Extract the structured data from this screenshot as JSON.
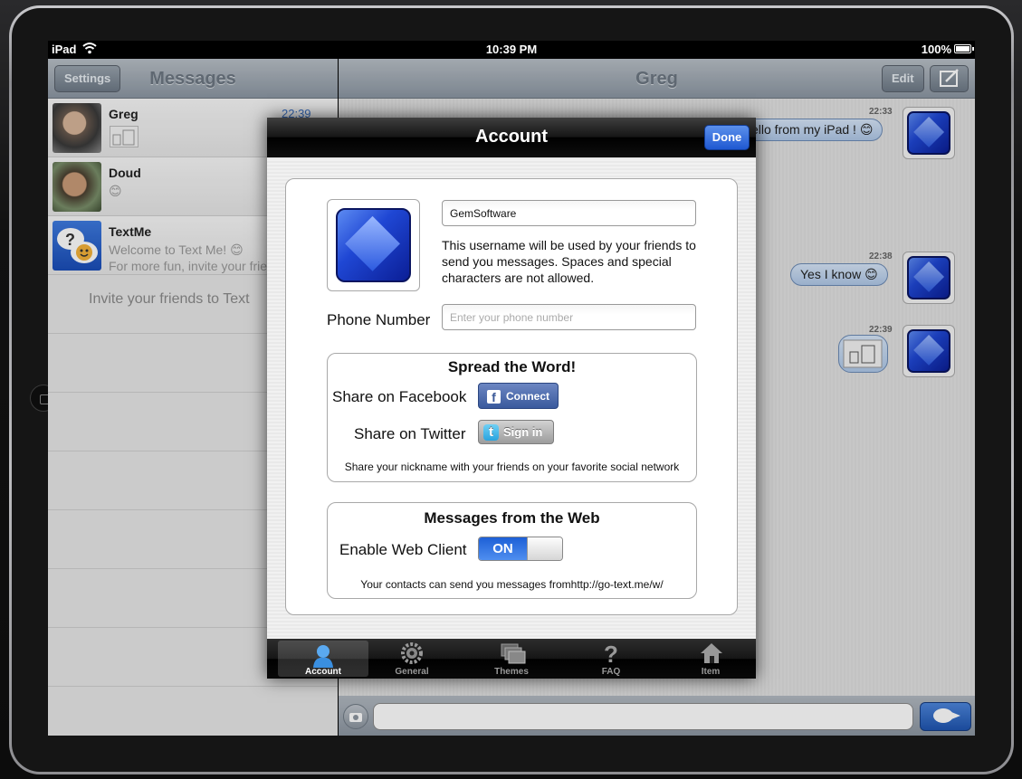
{
  "status_bar": {
    "carrier": "iPad",
    "time": "10:39 PM",
    "battery": "100%"
  },
  "master": {
    "title": "Messages",
    "settings_label": "Settings",
    "conversations": [
      {
        "name": "Greg",
        "time": "22:39",
        "preview": ""
      },
      {
        "name": "Doud",
        "time": "",
        "preview": "😊"
      },
      {
        "name": "TextMe",
        "time": "",
        "preview": "Welcome to Text Me! 😊",
        "preview2": "For more fun, invite your frie"
      }
    ],
    "invite_text": "Invite your friends to Text"
  },
  "detail": {
    "title": "Greg",
    "edit_label": "Edit",
    "messages": [
      {
        "time": "22:33",
        "text": "ello from my iPad ! 😊"
      },
      {
        "time": "22:38",
        "text": "Yes I know 😊"
      },
      {
        "time": "22:39",
        "text": ""
      }
    ]
  },
  "modal": {
    "title": "Account",
    "done_label": "Done",
    "username_value": "GemSoftware",
    "username_help": "This username will be used by your friends to send you messages. Spaces and special characters are not allowed.",
    "phone_label": "Phone Number",
    "phone_placeholder": "Enter your phone number",
    "spread": {
      "title": "Spread the Word!",
      "facebook_label": "Share on Facebook",
      "facebook_button": "Connect",
      "twitter_label": "Share on Twitter",
      "twitter_button": "Sign in",
      "note": "Share your nickname with your friends on your favorite social network"
    },
    "web": {
      "title": "Messages from the Web",
      "enable_label": "Enable Web Client",
      "toggle_state": "ON",
      "note": "Your contacts can send you messages fromhttp://go-text.me/w/"
    },
    "tabs": [
      {
        "label": "Account",
        "icon": "person-icon",
        "active": true
      },
      {
        "label": "General",
        "icon": "gear-icon",
        "active": false
      },
      {
        "label": "Themes",
        "icon": "themes-icon",
        "active": false
      },
      {
        "label": "FAQ",
        "icon": "question-icon",
        "active": false
      },
      {
        "label": "Item",
        "icon": "house-icon",
        "active": false
      }
    ]
  },
  "colors": {
    "accent_blue": "#1f58d1",
    "facebook": "#3b5998",
    "twitter": "#2aa3de"
  }
}
